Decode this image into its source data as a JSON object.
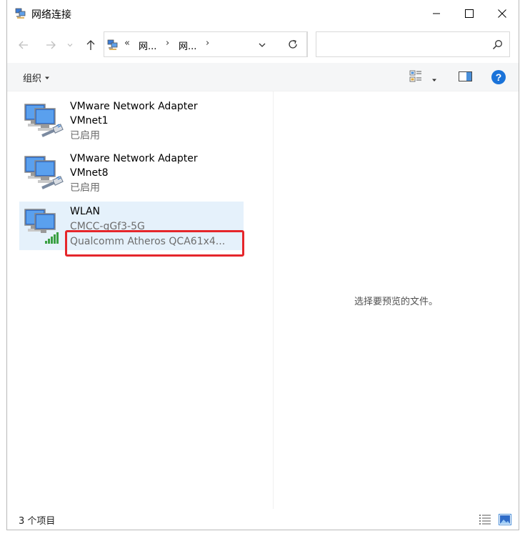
{
  "window": {
    "title": "网络连接",
    "accent": "#0078d7",
    "highlight_color": "#e5262b"
  },
  "nav": {
    "back_icon": "arrow-left-icon",
    "forward_icon": "arrow-right-icon",
    "recent_icon": "chevron-down-icon",
    "up_icon": "arrow-up-icon",
    "address": {
      "overflow": "«",
      "crumbs": [
        "网...",
        "网..."
      ],
      "sep": "›"
    },
    "refresh_icon": "refresh-icon",
    "search_placeholder": ""
  },
  "commandbar": {
    "organize_label": "组织",
    "view_icon": "change-view-icon",
    "preview_pane_icon": "preview-pane-icon",
    "help_icon": "help-icon"
  },
  "items": [
    {
      "name_line1": "VMware Network Adapter",
      "name_line2": "VMnet1",
      "status": "已启用",
      "icon": "ethernet-adapter-icon",
      "selected": false
    },
    {
      "name_line1": "VMware Network Adapter",
      "name_line2": "VMnet8",
      "status": "已启用",
      "icon": "ethernet-adapter-icon",
      "selected": false
    },
    {
      "name_line1": "WLAN",
      "network": "CMCC-gGf3-5G",
      "device": "Qualcomm Atheros QCA61x4...",
      "icon": "wifi-adapter-icon",
      "selected": true
    }
  ],
  "preview": {
    "empty_text": "选择要预览的文件。"
  },
  "statusbar": {
    "count_text": "3 个项目",
    "details_view_icon": "details-view-icon",
    "large_icons_view_icon": "large-icons-view-icon"
  }
}
